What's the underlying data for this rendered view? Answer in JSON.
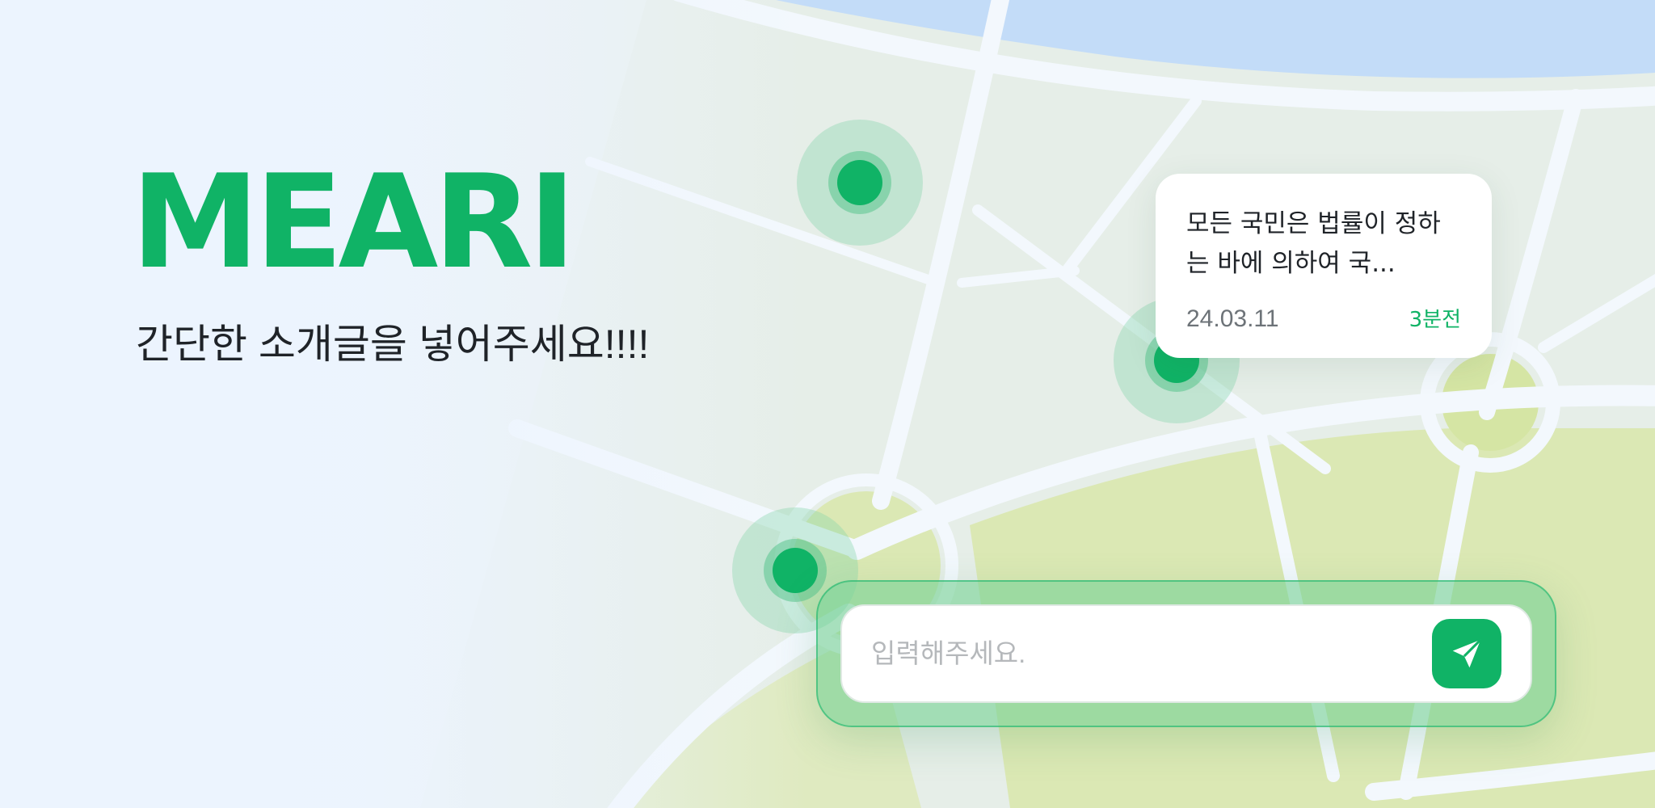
{
  "brand": {
    "title": "MEARI",
    "tagline": "간단한 소개글을 넣어주세요!!!!"
  },
  "pins": [
    {
      "name": "map-pin-1"
    },
    {
      "name": "map-pin-2"
    },
    {
      "name": "map-pin-3"
    }
  ],
  "bubble": {
    "text": "모든 국민은 법률이 정하는 바에 의하여 국...",
    "date": "24.03.11",
    "time_ago": "3분전"
  },
  "input": {
    "placeholder": "입력해주세요.",
    "value": "",
    "send_icon": "send-icon"
  },
  "colors": {
    "brand": "#10b366",
    "background": "#eef5fd",
    "map_block": "#e6efe8",
    "map_park": "#dbe8b4",
    "map_water": "#c3dcf8",
    "road": "#f2f7fc"
  }
}
